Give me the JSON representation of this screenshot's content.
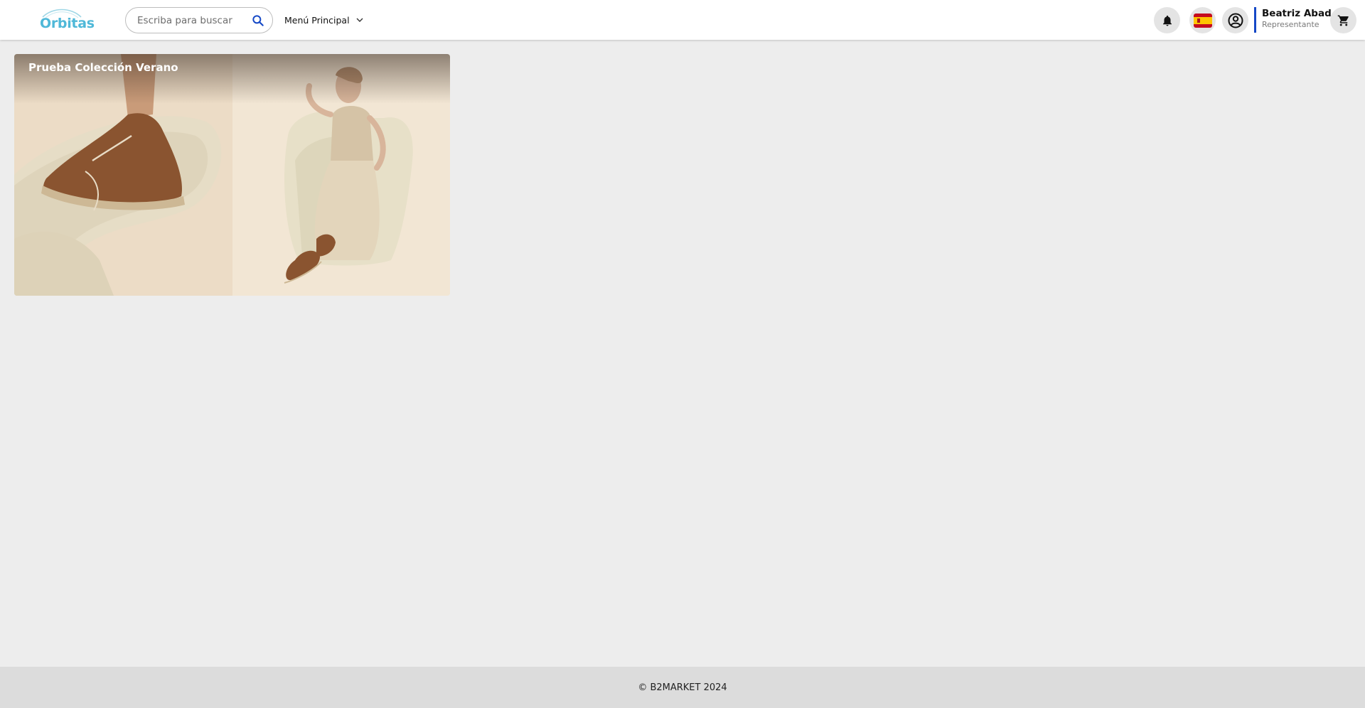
{
  "header": {
    "logo_text": "Orbitas",
    "search": {
      "placeholder": "Escriba para buscar",
      "value": ""
    },
    "menu_label": "Menú Principal",
    "user": {
      "name": "Beatriz Abad",
      "role": "Representante"
    },
    "language": "es"
  },
  "main": {
    "collections": [
      {
        "title": "Prueba Colección Verano"
      }
    ]
  },
  "footer": {
    "copyright": "© B2MARKET 2024"
  },
  "colors": {
    "accent": "#1548c6",
    "logo": "#4fb8d8",
    "page_bg": "#ededed",
    "footer_bg": "#dcdcdc"
  },
  "icons": [
    "search-icon",
    "chevron-down-icon",
    "bell-icon",
    "spain-flag-icon",
    "account-circle-icon",
    "cart-icon"
  ]
}
